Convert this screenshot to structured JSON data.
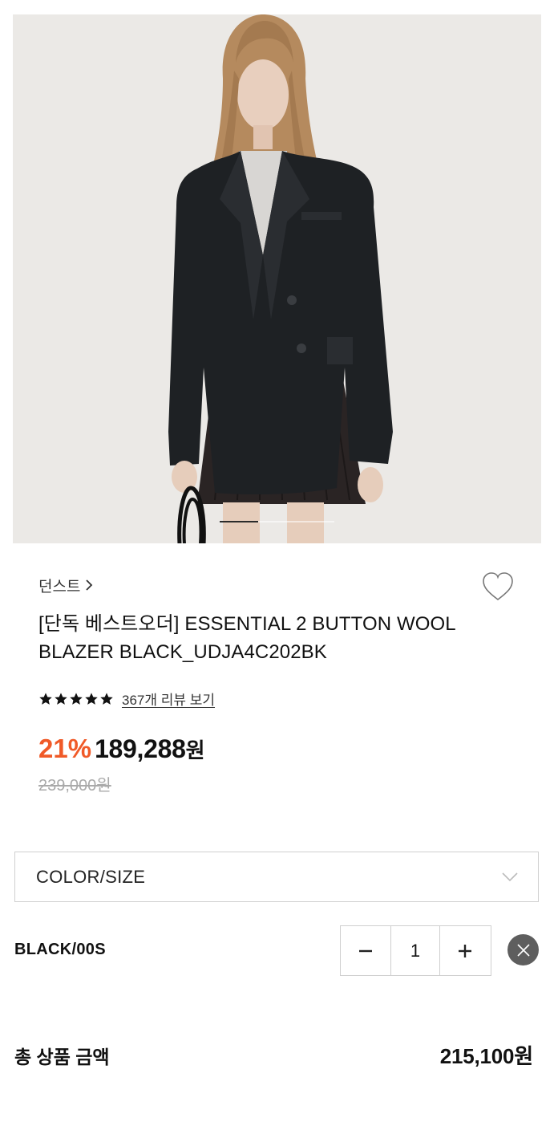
{
  "product": {
    "image_alt": "Model wearing black wool blazer",
    "carousel": {
      "total": 3,
      "current": 1
    },
    "brand": "던스트",
    "title": "[단독 베스트오더] ESSENTIAL 2 BUTTON WOOL BLAZER BLACK_UDJA4C202BK",
    "rating": {
      "stars": 5,
      "review_link": "367개 리뷰 보기"
    },
    "discount": "21%",
    "price": "189,288",
    "price_unit": "원",
    "original_price": "239,000원"
  },
  "option": {
    "placeholder": "COLOR/SIZE",
    "selected_label": "BLACK/00S",
    "quantity": "1"
  },
  "total": {
    "label": "총 상품 금액",
    "value": "215,100원"
  },
  "colors": {
    "discount": "#f05a28",
    "remove_button": "#5e5e5e"
  }
}
